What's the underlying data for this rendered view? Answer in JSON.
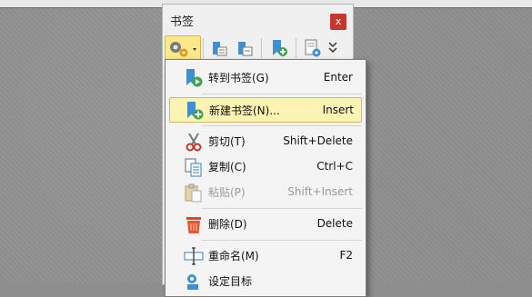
{
  "panel": {
    "title": "书签",
    "close_glyph": "x"
  },
  "toolbar": {
    "icons": [
      "bookmark-options-gear-icon",
      "dropdown-caret-icon",
      "expand-bookmarks-icon",
      "collapse-bookmarks-icon",
      "add-bookmark-icon",
      "bookmark-properties-icon",
      "more-chevron-icon"
    ]
  },
  "menu": {
    "items": [
      {
        "label": "转到书签(G)",
        "shortcut": "Enter",
        "icon": "goto-bookmark-icon"
      },
      {
        "label": "新建书签(N)...",
        "shortcut": "Insert",
        "icon": "new-bookmark-icon"
      },
      {
        "label": "剪切(T)",
        "shortcut": "Shift+Delete",
        "icon": "scissors-icon"
      },
      {
        "label": "复制(C)",
        "shortcut": "Ctrl+C",
        "icon": "copy-icon"
      },
      {
        "label": "粘贴(P)",
        "shortcut": "Shift+Insert",
        "icon": "paste-icon"
      },
      {
        "label": "删除(D)",
        "shortcut": "Delete",
        "icon": "trash-icon"
      },
      {
        "label": "重命名(M)",
        "shortcut": "F2",
        "icon": "rename-icon"
      },
      {
        "label": "设定目标",
        "shortcut": "",
        "icon": "set-target-icon"
      }
    ]
  },
  "colors": {
    "highlight": "#fdf3b5",
    "close_button": "#c7362f"
  }
}
